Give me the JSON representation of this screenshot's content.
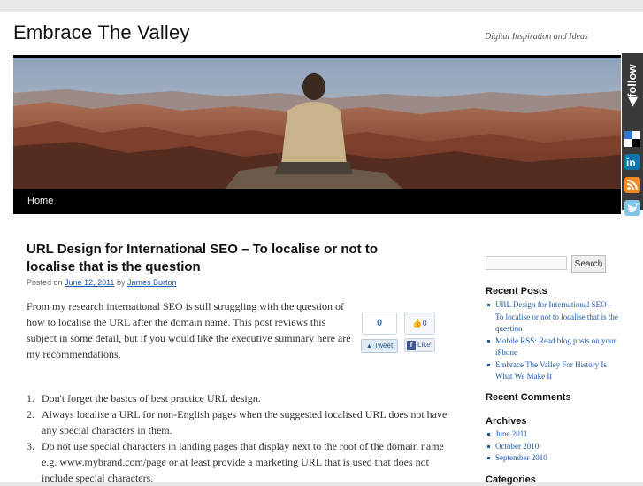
{
  "site": {
    "title": "Embrace The Valley",
    "tagline": "Digital Inspiration and Ideas"
  },
  "nav": {
    "items": [
      {
        "label": "Home"
      }
    ]
  },
  "follow": {
    "label": "follow",
    "icons": [
      "delicious-icon",
      "linkedin-icon",
      "rss-icon",
      "twitter-icon"
    ]
  },
  "post": {
    "title": "URL Design for International SEO – To localise or not to localise that is the question",
    "meta_prefix": "Posted on",
    "date": "June 12, 2011",
    "by": "by",
    "author": "James Burton",
    "intro": "From my research international SEO is still struggling with the question of how to localise the URL after the domain name. This post reviews this subject in some detail, but if you would like the executive summary here are my recommendations.",
    "tweet_count": "0",
    "tweet_label": "Tweet",
    "fb_count": "0",
    "like_label": "Like",
    "list": [
      {
        "num": "1.",
        "text": "Don't forget the basics of best practice URL design."
      },
      {
        "num": "2.",
        "text": "Always localise a URL for non-English pages when the suggested localised URL does not have any special characters in them."
      },
      {
        "num": "3.",
        "text": "Do not use special characters in landing pages that display next to the root of the domain name e.g. www.mybrand.com/page or at least provide a marketing URL that is used that does not include special characters."
      }
    ]
  },
  "sidebar": {
    "search": {
      "value": "",
      "button": "Search"
    },
    "recent_posts": {
      "title": "Recent Posts",
      "items": [
        "URL Design for International SEO – To localise or not to localise that is the question",
        "Mobile RSS: Read blog posts on your iPhone",
        "Embrace The Valley For History Is What We Make It"
      ]
    },
    "recent_comments": {
      "title": "Recent Comments"
    },
    "archives": {
      "title": "Archives",
      "items": [
        "June 2011",
        "October 2010",
        "September 2010"
      ]
    },
    "categories": {
      "title": "Categories"
    }
  },
  "colors": {
    "link": "#1b5aa8",
    "nav_bg": "#000000",
    "follow_bg": "#3a3a3a"
  }
}
